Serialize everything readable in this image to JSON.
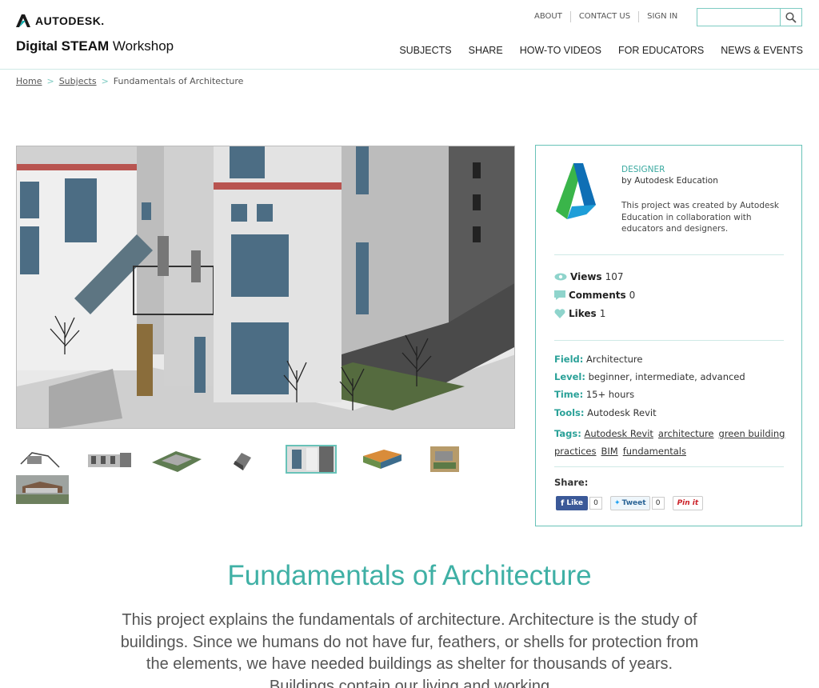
{
  "brand": {
    "name": "AUTODESK.",
    "site_title_bold": "Digital STEAM",
    "site_title_rest": " Workshop"
  },
  "util_nav": [
    "ABOUT",
    "CONTACT US",
    "SIGN IN"
  ],
  "search": {
    "placeholder": ""
  },
  "main_nav": [
    "SUBJECTS",
    "SHARE",
    "HOW-TO VIDEOS",
    "FOR EDUCATORS",
    "NEWS & EVENTS"
  ],
  "breadcrumb": {
    "home": "Home",
    "subjects": "Subjects",
    "current": "Fundamentals of Architecture",
    "sep": ">"
  },
  "designer": {
    "label": "DESIGNER",
    "by": "by Autodesk Education",
    "description": "This project was created by Autodesk Education in collaboration with educators and designers."
  },
  "stats": {
    "views_label": "Views",
    "views": "107",
    "comments_label": "Comments",
    "comments": "0",
    "likes_label": "Likes",
    "likes": "1"
  },
  "meta": {
    "field_label": "Field:",
    "field": "Architecture",
    "level_label": "Level:",
    "level": "beginner, intermediate, advanced",
    "time_label": "Time:",
    "time": "15+ hours",
    "tools_label": "Tools:",
    "tools": "Autodesk Revit",
    "tags_label": "Tags:",
    "tags": [
      "Autodesk Revit",
      "architecture",
      "green building practices",
      "BIM",
      "fundamentals"
    ]
  },
  "share": {
    "label": "Share:",
    "fb_label": "Like",
    "fb_count": "0",
    "tw_label": "Tweet",
    "tw_count": "0",
    "pin_label": "Pin it"
  },
  "page": {
    "title": "Fundamentals of Architecture",
    "intro": "This project explains the fundamentals of architecture.  Architecture is the study of buildings.  Since we humans do not have fur, feathers, or shells for protection from the elements, we have needed buildings as shelter for thousands of years. Buildings contain our living and working"
  },
  "colors": {
    "accent": "#3fb0a5",
    "border": "#68c2b8"
  }
}
